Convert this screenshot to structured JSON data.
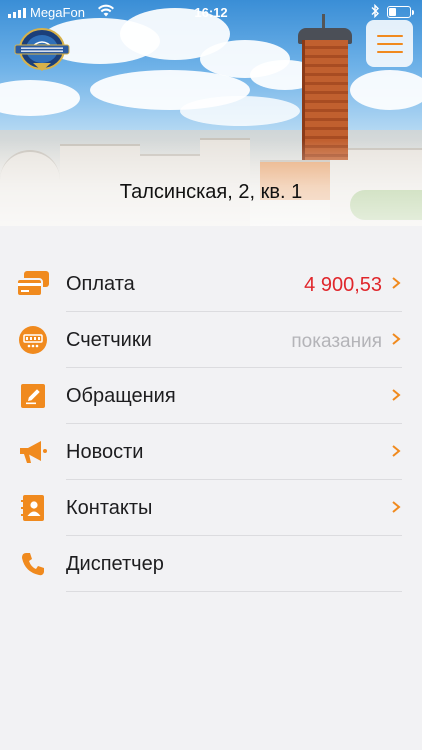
{
  "status_bar": {
    "carrier": "MegaFon",
    "time": "16:12",
    "battery_level": 0.35
  },
  "header": {
    "address": "Талсинская, 2, кв. 1",
    "logo_icon": "organization-logo-icon",
    "menu_icon": "hamburger-menu-icon"
  },
  "menu": {
    "items": [
      {
        "label": "Оплата",
        "value": "4 900,53",
        "icon": "payment-cards-icon",
        "has_chevron": true
      },
      {
        "label": "Счетчики",
        "value": "показания",
        "icon": "meter-icon",
        "has_chevron": true
      },
      {
        "label": "Обращения",
        "value": "",
        "icon": "edit-request-icon",
        "has_chevron": true
      },
      {
        "label": "Новости",
        "value": "",
        "icon": "megaphone-icon",
        "has_chevron": true
      },
      {
        "label": "Контакты",
        "value": "",
        "icon": "contacts-book-icon",
        "has_chevron": true
      },
      {
        "label": "Диспетчер",
        "value": "",
        "icon": "phone-icon",
        "has_chevron": false
      }
    ]
  },
  "colors": {
    "accent": "#f08a1e",
    "price": "#e0262b",
    "hint": "#b4b4b8",
    "background": "#f2f2f4"
  }
}
